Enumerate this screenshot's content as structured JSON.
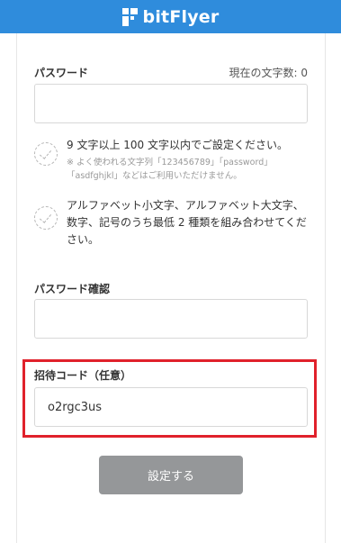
{
  "header": {
    "brand": "bitFlyer",
    "brand_color": "#2f8cdc"
  },
  "password": {
    "label": "パスワード",
    "counter": "現在の文字数: 0",
    "value": ""
  },
  "rules": [
    {
      "text": "9 文字以上 100 文字以内でご設定ください。",
      "note": "※ よく使われる文字列「123456789」「password」「asdfghjkl」などはご利用いただけません。"
    },
    {
      "text": "アルファベット小文字、アルファベット大文字、数字、記号のうち最低 2 種類を組み合わせてください。",
      "note": ""
    }
  ],
  "password_confirm": {
    "label": "パスワード確認",
    "value": ""
  },
  "invite": {
    "label": "招待コード（任意）",
    "value": "o2rgc3us",
    "highlight_color": "#e0212b"
  },
  "submit": {
    "label": "設定する",
    "state": "disabled"
  }
}
